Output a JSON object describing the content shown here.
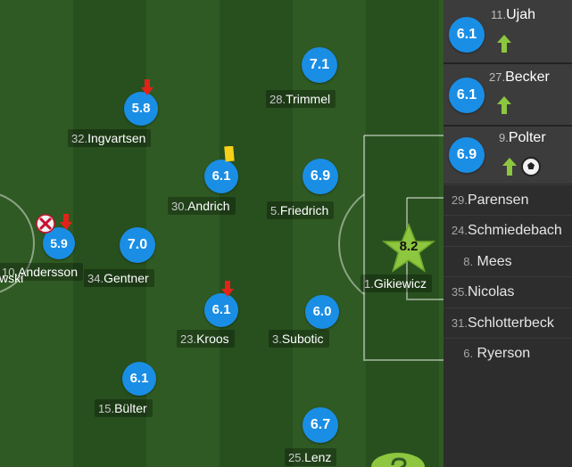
{
  "colors": {
    "rating": "#1a8ee5",
    "star": "#8dc63f",
    "sub_in_arrow": "#8dc63f",
    "sub_out_arrow": "#e2231a",
    "yellow_card": "#f7d117"
  },
  "players": [
    {
      "id": "trimmel",
      "number": "28.",
      "name": "Trimmel",
      "rating": "7.1"
    },
    {
      "id": "ingvartsen",
      "number": "32.",
      "name": "Ingvartsen",
      "rating": "5.8",
      "icons": [
        "sub-out-arrow-icon"
      ]
    },
    {
      "id": "andrich",
      "number": "30.",
      "name": "Andrich",
      "rating": "6.1",
      "icons": [
        "yellow-card-icon"
      ]
    },
    {
      "id": "friedrich",
      "number": "5.",
      "name": "Friedrich",
      "rating": "6.9"
    },
    {
      "id": "andersson",
      "number": "10.",
      "name": "Andersson",
      "rating": "5.9",
      "icons": [
        "injury-icon",
        "sub-out-arrow-icon"
      ]
    },
    {
      "id": "gentner",
      "number": "34.",
      "name": "Gentner",
      "rating": "7.0"
    },
    {
      "id": "gikiewicz",
      "number": "1.",
      "name": "Gikiewicz",
      "rating": "8.2",
      "icons": [
        "star-icon"
      ]
    },
    {
      "id": "kroos",
      "number": "23.",
      "name": "Kroos",
      "rating": "6.1",
      "icons": [
        "sub-out-arrow-icon"
      ]
    },
    {
      "id": "subotic",
      "number": "3.",
      "name": "Subotic",
      "rating": "6.0"
    },
    {
      "id": "bulter",
      "number": "15.",
      "name": "Bülter",
      "rating": "6.1"
    },
    {
      "id": "lenz",
      "number": "25.",
      "name": "Lenz",
      "rating": "6.7"
    },
    {
      "id": "cutoff-left",
      "name": "wski"
    }
  ],
  "substitutes": [
    {
      "number": "11.",
      "name": "Ujah",
      "rating": "6.1",
      "icons": [
        "sub-in-arrow-icon"
      ]
    },
    {
      "number": "27.",
      "name": "Becker",
      "rating": "6.1",
      "icons": [
        "sub-in-arrow-icon"
      ]
    },
    {
      "number": "9.",
      "name": "Polter",
      "rating": "6.9",
      "icons": [
        "sub-in-arrow-icon",
        "goal-ball-icon"
      ]
    }
  ],
  "bench": [
    {
      "number": "29.",
      "name": "Parensen"
    },
    {
      "number": "24.",
      "name": "Schmiedebach"
    },
    {
      "number": "8.",
      "name": "Mees"
    },
    {
      "number": "35.",
      "name": "Nicolas"
    },
    {
      "number": "31.",
      "name": "Schlotterbeck"
    },
    {
      "number": "6.",
      "name": "Ryerson"
    }
  ]
}
